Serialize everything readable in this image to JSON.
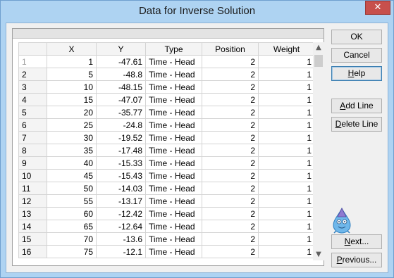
{
  "window": {
    "title": "Data for Inverse Solution",
    "close_glyph": "✕"
  },
  "grid": {
    "columns": [
      "",
      "X",
      "Y",
      "Type",
      "Position",
      "Weight"
    ],
    "rows": [
      [
        "1",
        "1",
        "-47.61",
        "Time - Head",
        "2",
        "1"
      ],
      [
        "2",
        "5",
        "-48.8",
        "Time - Head",
        "2",
        "1"
      ],
      [
        "3",
        "10",
        "-48.15",
        "Time - Head",
        "2",
        "1"
      ],
      [
        "4",
        "15",
        "-47.07",
        "Time - Head",
        "2",
        "1"
      ],
      [
        "5",
        "20",
        "-35.77",
        "Time - Head",
        "2",
        "1"
      ],
      [
        "6",
        "25",
        "-24.8",
        "Time - Head",
        "2",
        "1"
      ],
      [
        "7",
        "30",
        "-19.52",
        "Time - Head",
        "2",
        "1"
      ],
      [
        "8",
        "35",
        "-17.48",
        "Time - Head",
        "2",
        "1"
      ],
      [
        "9",
        "40",
        "-15.33",
        "Time - Head",
        "2",
        "1"
      ],
      [
        "10",
        "45",
        "-15.43",
        "Time - Head",
        "2",
        "1"
      ],
      [
        "11",
        "50",
        "-14.03",
        "Time - Head",
        "2",
        "1"
      ],
      [
        "12",
        "55",
        "-13.17",
        "Time - Head",
        "2",
        "1"
      ],
      [
        "13",
        "60",
        "-12.42",
        "Time - Head",
        "2",
        "1"
      ],
      [
        "14",
        "65",
        "-12.64",
        "Time - Head",
        "2",
        "1"
      ],
      [
        "15",
        "70",
        "-13.6",
        "Time - Head",
        "2",
        "1"
      ],
      [
        "16",
        "75",
        "-12.1",
        "Time - Head",
        "2",
        "1"
      ]
    ],
    "selected_row_index": 0,
    "scroll_up_glyph": "▲",
    "scroll_down_glyph": "▼"
  },
  "buttons": {
    "ok": "OK",
    "cancel": "Cancel",
    "help": {
      "mnemonic": "H",
      "rest": "elp"
    },
    "add_line": {
      "mnemonic": "A",
      "rest": "dd Line"
    },
    "delete_line": {
      "mnemonic": "D",
      "rest": "elete Line"
    },
    "next": {
      "mnemonic": "N",
      "rest": "ext..."
    },
    "previous": {
      "mnemonic": "P",
      "rest": "revious..."
    }
  },
  "mascot": {
    "icon": "water-drop-mascot-icon"
  }
}
